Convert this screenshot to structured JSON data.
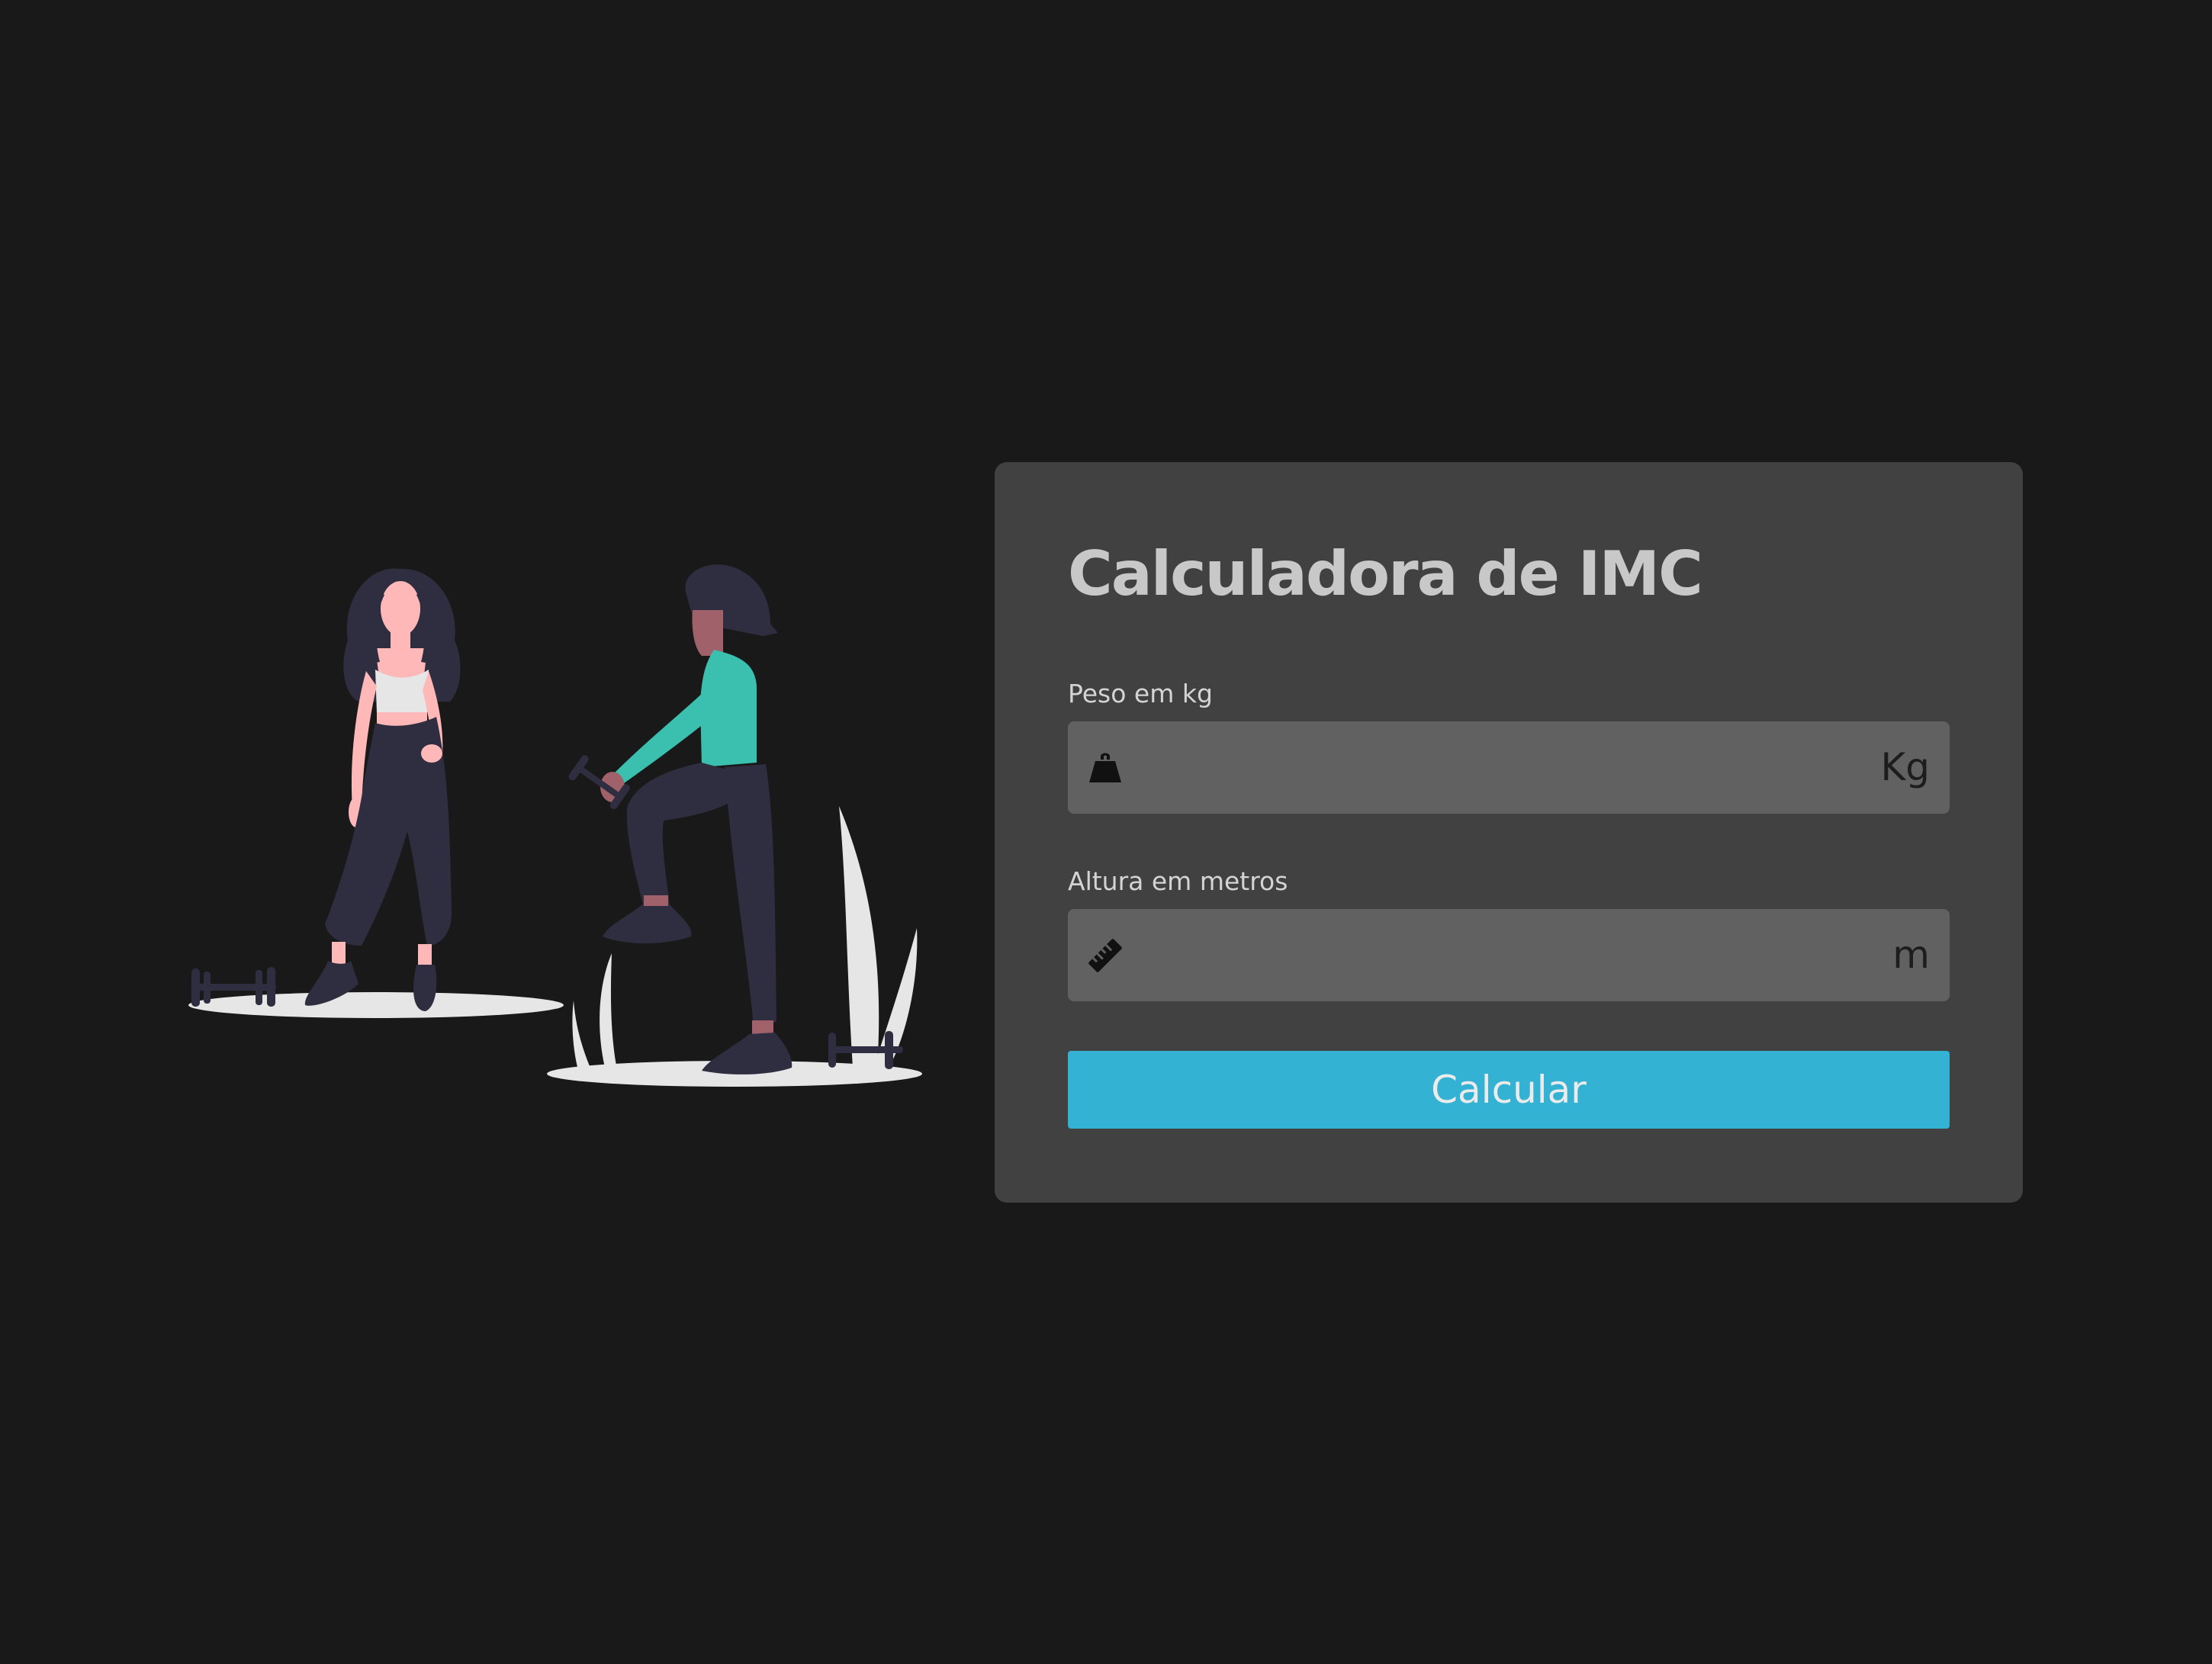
{
  "calculator": {
    "title": "Calculadora de IMC",
    "weight": {
      "label": "Peso em kg",
      "value": "",
      "unit": "Kg",
      "icon": "weight-icon"
    },
    "height": {
      "label": "Altura em metros",
      "value": "",
      "unit": "m",
      "icon": "ruler-icon"
    },
    "button_label": "Calcular"
  },
  "colors": {
    "background": "#191919",
    "card": "#414141",
    "input": "#616161",
    "accent": "#33b2d3"
  },
  "illustration": {
    "subject": "fitness-illustration"
  }
}
